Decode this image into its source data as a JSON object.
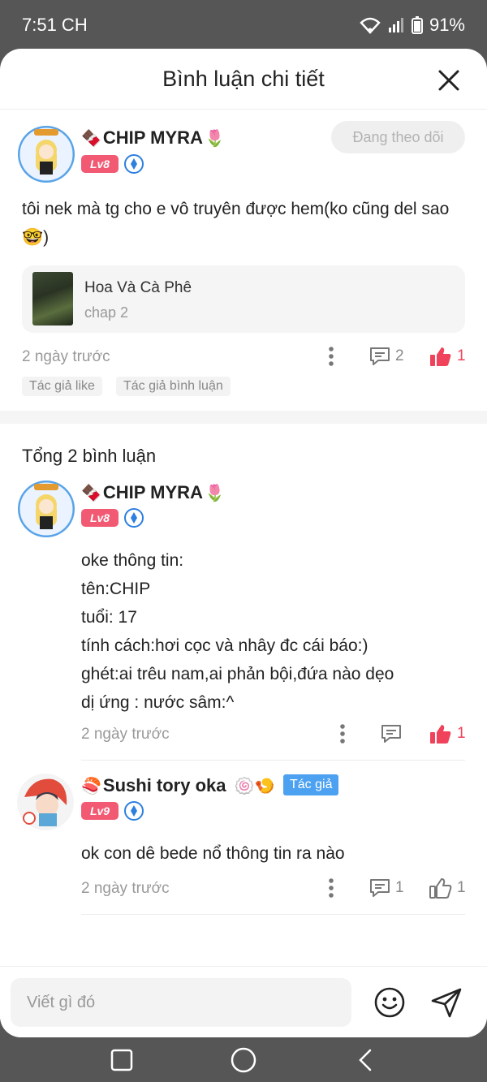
{
  "status": {
    "time": "7:51 CH",
    "battery": "91%"
  },
  "header": {
    "title": "Bình luận chi tiết"
  },
  "main_comment": {
    "author": "CHIP MYRA",
    "emoji_before": "🍫",
    "emoji_after": "🌷",
    "level": "Lv8",
    "follow_label": "Đang theo dõi",
    "text": "tôi nek mà tg cho e vô truyên được hem(ko cũng del sao🤓)",
    "story": {
      "title": "Hoa Và Cà Phê",
      "chapter": "chap 2"
    },
    "time": "2 ngày trước",
    "reply_count": "2",
    "like_count": "1",
    "chips": [
      "Tác giả like",
      "Tác giả bình luận"
    ]
  },
  "replies_header": "Tổng 2 bình luận",
  "replies": [
    {
      "author": "CHIP MYRA",
      "emoji_before": "🍫",
      "emoji_after": "🌷",
      "level": "Lv8",
      "lines": [
        "oke thông tin:",
        "tên:CHIP",
        "tuổi: 17",
        "tính cách:hơi cọc và nhây đc cái báo:)",
        "ghét:ai trêu nam,ai phản bội,đứa nào dẹo",
        "dị ứng : nước sâm:^"
      ],
      "time": "2 ngày trước",
      "reply_count": "",
      "like_count": "1"
    },
    {
      "author": "Sushi tory oka",
      "emoji_before": "🍣",
      "emoji_after": "🍥🍤",
      "author_tag": "Tác giả",
      "level": "Lv9",
      "lines": [
        "ok con dê bede nổ thông tin ra nào"
      ],
      "time": "2 ngày trước",
      "reply_count": "1",
      "like_count": "1"
    }
  ],
  "composer": {
    "placeholder": "Viết gì đó"
  },
  "colors": {
    "accent_red": "#f0435b",
    "level_badge": "#f25a73",
    "author_tag": "#4da1f1"
  }
}
